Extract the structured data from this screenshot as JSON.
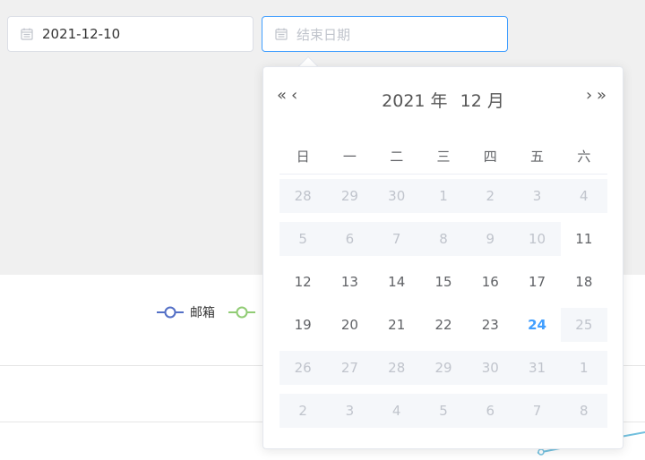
{
  "start_input": {
    "value": "2021-12-10",
    "icon": "calendar-icon"
  },
  "end_input": {
    "placeholder": "结束日期",
    "icon": "calendar-icon"
  },
  "chart": {
    "legend": [
      {
        "label": "邮箱",
        "color": "#5470c6"
      },
      {
        "label": "",
        "color": "#91cc75"
      }
    ],
    "line_color": "#73c0de"
  },
  "calendar": {
    "nav": {
      "prev_year": "«",
      "prev_month": "‹",
      "next_month": "›",
      "next_year": "»"
    },
    "year_label": "2021 年",
    "month_label": "12 月",
    "weekdays": [
      "日",
      "一",
      "二",
      "三",
      "四",
      "五",
      "六"
    ],
    "weeks": [
      [
        {
          "d": "28",
          "s": "other"
        },
        {
          "d": "29",
          "s": "other"
        },
        {
          "d": "30",
          "s": "other"
        },
        {
          "d": "1",
          "s": "disabled"
        },
        {
          "d": "2",
          "s": "disabled"
        },
        {
          "d": "3",
          "s": "disabled"
        },
        {
          "d": "4",
          "s": "disabled"
        }
      ],
      [
        {
          "d": "5",
          "s": "disabled"
        },
        {
          "d": "6",
          "s": "disabled"
        },
        {
          "d": "7",
          "s": "disabled"
        },
        {
          "d": "8",
          "s": "disabled"
        },
        {
          "d": "9",
          "s": "disabled"
        },
        {
          "d": "10",
          "s": "disabled"
        },
        {
          "d": "11",
          "s": "available"
        }
      ],
      [
        {
          "d": "12",
          "s": "available"
        },
        {
          "d": "13",
          "s": "available"
        },
        {
          "d": "14",
          "s": "available"
        },
        {
          "d": "15",
          "s": "available"
        },
        {
          "d": "16",
          "s": "available"
        },
        {
          "d": "17",
          "s": "available"
        },
        {
          "d": "18",
          "s": "available"
        }
      ],
      [
        {
          "d": "19",
          "s": "available"
        },
        {
          "d": "20",
          "s": "available"
        },
        {
          "d": "21",
          "s": "available"
        },
        {
          "d": "22",
          "s": "available"
        },
        {
          "d": "23",
          "s": "available"
        },
        {
          "d": "24",
          "s": "today"
        },
        {
          "d": "25",
          "s": "disabled"
        }
      ],
      [
        {
          "d": "26",
          "s": "disabled"
        },
        {
          "d": "27",
          "s": "disabled"
        },
        {
          "d": "28",
          "s": "disabled"
        },
        {
          "d": "29",
          "s": "disabled"
        },
        {
          "d": "30",
          "s": "disabled"
        },
        {
          "d": "31",
          "s": "disabled"
        },
        {
          "d": "1",
          "s": "other"
        }
      ],
      [
        {
          "d": "2",
          "s": "other"
        },
        {
          "d": "3",
          "s": "other"
        },
        {
          "d": "4",
          "s": "other"
        },
        {
          "d": "5",
          "s": "other"
        },
        {
          "d": "6",
          "s": "other"
        },
        {
          "d": "7",
          "s": "other"
        },
        {
          "d": "8",
          "s": "other"
        }
      ]
    ],
    "today_color": "#409eff"
  }
}
